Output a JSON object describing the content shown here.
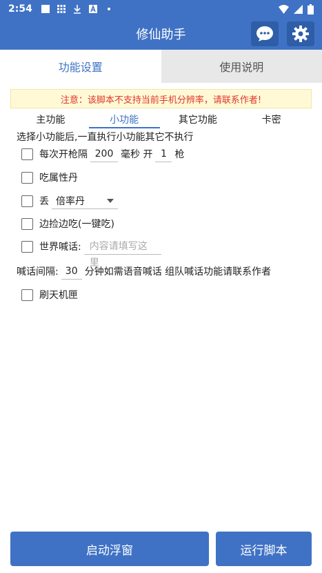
{
  "status": {
    "time": "2:54",
    "icons": [
      "square-icon",
      "grid-icon",
      "download-icon",
      "a-icon",
      "dot-icon"
    ],
    "right_icons": [
      "wifi-icon",
      "signal-icon",
      "battery-icon"
    ]
  },
  "appbar": {
    "title": "修仙助手",
    "chat_icon": "chat-icon",
    "settings_icon": "gear-icon"
  },
  "main_tabs": [
    "功能设置",
    "使用说明"
  ],
  "warning": "注意：该脚本不支持当前手机分辨率，请联系作者!",
  "sub_tabs": [
    "主功能",
    "小功能",
    "其它功能",
    "卡密"
  ],
  "description": "选择小功能后,一直执行小功能其它不执行",
  "rows": {
    "fire": {
      "label_a": "每次开枪隔",
      "value_ms": "200",
      "label_b": "毫秒 开",
      "value_count": "1",
      "label_c": "枪"
    },
    "eat_pill": {
      "label": "吃属性丹"
    },
    "drop": {
      "label": "丢",
      "selected": "倍率丹"
    },
    "pickup": {
      "label": "边捡边吃(一键吃)"
    },
    "shout": {
      "label": "世界喊话:",
      "placeholder": "内容请填写这里"
    },
    "interval": {
      "label_a": "喊话间隔:",
      "value": "30",
      "label_b": "分钟如需语音喊话 组队喊话功能请联系作者"
    },
    "box": {
      "label": "刷天机匣"
    }
  },
  "buttons": {
    "float": "启动浮窗",
    "run": "运行脚本"
  },
  "colors": {
    "primary": "#3f72c4",
    "warning_text": "#e0362c",
    "warning_bg": "#fff9d6"
  }
}
